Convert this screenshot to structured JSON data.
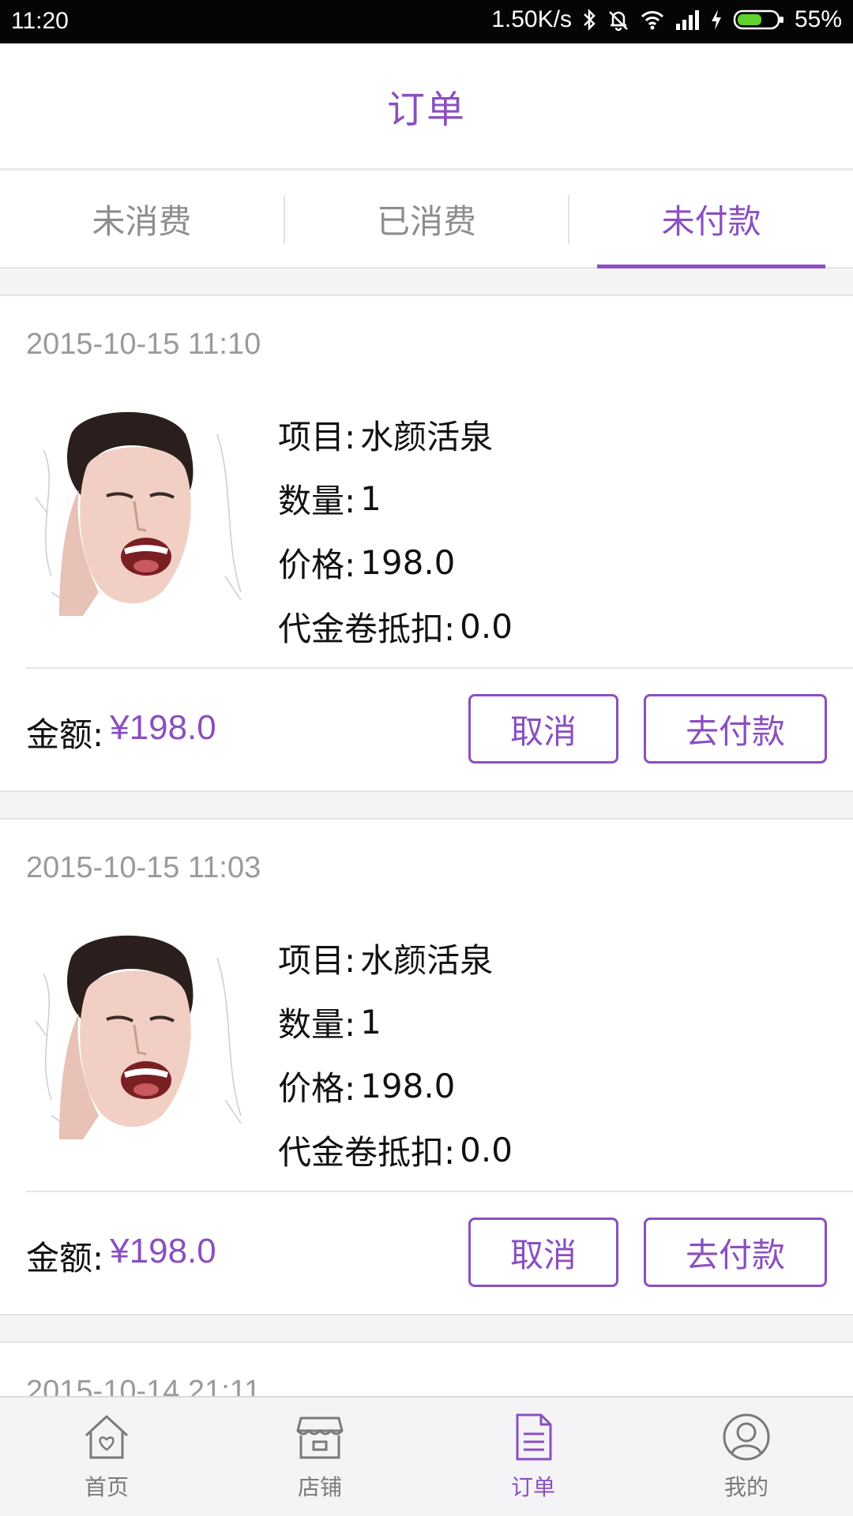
{
  "status_bar": {
    "time": "11:20",
    "net_speed": "1.50K/s",
    "battery": "55%"
  },
  "header": {
    "title": "订单"
  },
  "tabs": [
    {
      "label": "未消费",
      "active": false
    },
    {
      "label": "已消费",
      "active": false
    },
    {
      "label": "未付款",
      "active": true
    }
  ],
  "labels": {
    "project": "项目:",
    "quantity": "数量:",
    "price": "价格:",
    "voucher": "代金卷抵扣:",
    "amount": "金额:",
    "cancel": "取消",
    "pay": "去付款"
  },
  "orders": [
    {
      "date": "2015-10-15 11:10",
      "project": "水颜活泉",
      "quantity": "1",
      "price": "198.0",
      "voucher": "0.0",
      "amount": "¥198.0",
      "image": "woman-splash-photo"
    },
    {
      "date": "2015-10-15 11:03",
      "project": "水颜活泉",
      "quantity": "1",
      "price": "198.0",
      "voucher": "0.0",
      "amount": "¥198.0",
      "image": "woman-splash-photo"
    },
    {
      "date": "2015-10-14 21:11"
    }
  ],
  "bottom_nav": [
    {
      "label": "首页",
      "icon": "home-icon",
      "active": false
    },
    {
      "label": "店铺",
      "icon": "store-icon",
      "active": false
    },
    {
      "label": "订单",
      "icon": "order-document-icon",
      "active": true
    },
    {
      "label": "我的",
      "icon": "profile-icon",
      "active": false
    }
  ],
  "colors": {
    "accent": "#8a4fc1",
    "muted_text": "#8d8d8d",
    "background": "#f4f4f6"
  }
}
